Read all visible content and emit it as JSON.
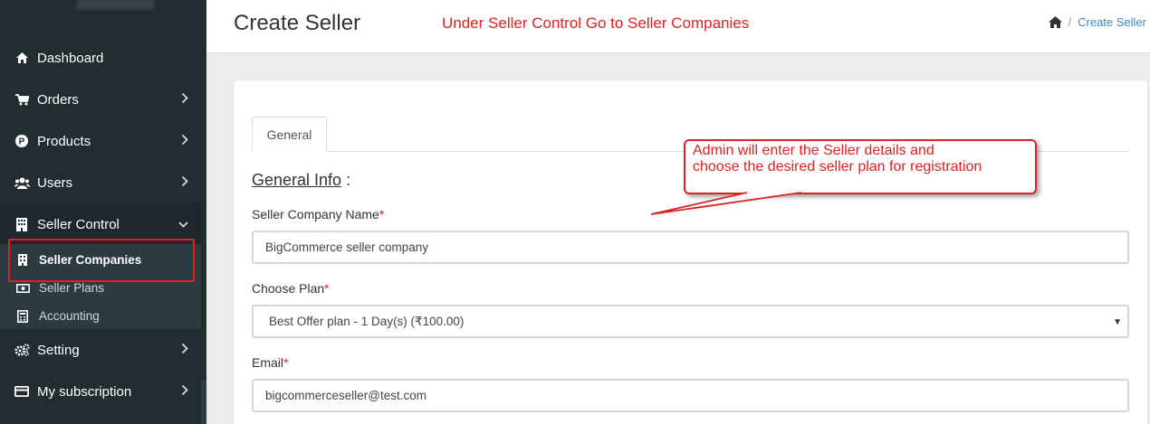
{
  "header": {
    "title": "Create Seller",
    "annotation": "Under Seller Control Go to Seller Companies",
    "breadcrumb": {
      "home_icon": "home-icon",
      "current": "Create Seller"
    }
  },
  "sidebar": {
    "items": [
      {
        "label": "Dashboard",
        "icon": "dashboard-icon"
      },
      {
        "label": "Orders",
        "icon": "cart-icon",
        "has_submenu": true
      },
      {
        "label": "Products",
        "icon": "product-icon",
        "has_submenu": true
      },
      {
        "label": "Users",
        "icon": "users-icon",
        "has_submenu": true
      },
      {
        "label": "Seller Control",
        "icon": "building-icon",
        "expanded": true
      },
      {
        "label": "Setting",
        "icon": "cogs-icon",
        "has_submenu": true
      },
      {
        "label": "My subscription",
        "icon": "credit-card-icon",
        "has_submenu": true
      }
    ],
    "seller_control_submenu": [
      {
        "label": "Seller Companies",
        "icon": "building-icon",
        "selected": true
      },
      {
        "label": "Seller Plans",
        "icon": "money-icon"
      },
      {
        "label": "Accounting",
        "icon": "calculator-icon"
      }
    ]
  },
  "form": {
    "tab_label": "General",
    "section_title": "General Info",
    "section_suffix": " :",
    "required_marker": "*",
    "company_name_label": "Seller Company Name",
    "company_name_value": "BigCommerce seller company",
    "plan_label": "Choose Plan",
    "plan_value": "Best Offer plan - 1 Day(s) (₹100.00)",
    "email_label": "Email",
    "email_value": "bigcommerceseller@test.com"
  },
  "callout": {
    "line1": "Admin will enter the Seller details and",
    "line2": "choose the desired seller plan for registration"
  },
  "colors": {
    "sidebar_bg": "#222d32",
    "submenu_bg": "#2c3b41",
    "annotation_red": "#e01f1f",
    "link_blue": "#3c8dbc"
  }
}
